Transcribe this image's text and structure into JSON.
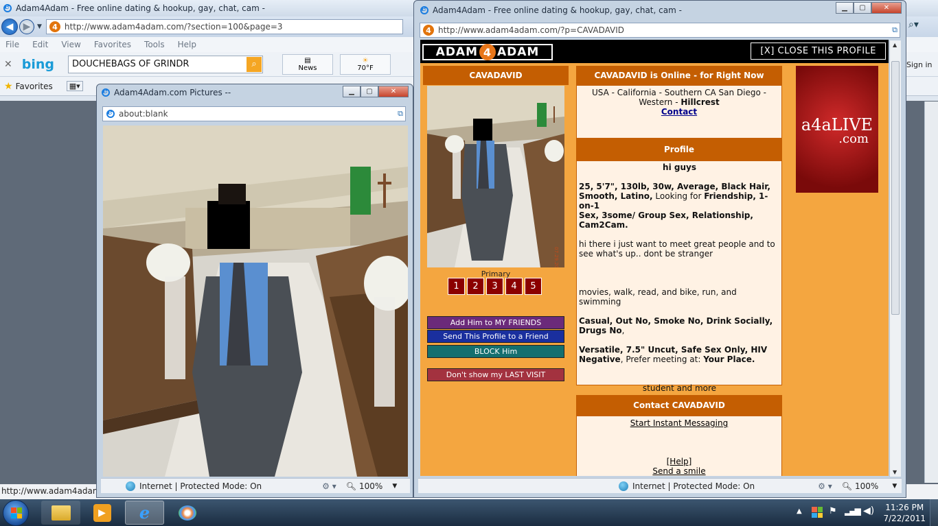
{
  "background_window": {
    "title": "Adam4Adam - Free online dating & hookup, gay, chat, cam -",
    "address": "http://www.adam4adam.com/?section=100&page=3",
    "menu": [
      "File",
      "Edit",
      "View",
      "Favorites",
      "Tools",
      "Help"
    ],
    "bing_search_value": "DOUCHEBAGS OF GRINDR",
    "news_label": "News",
    "weather_label": "70°F",
    "favorites_label": "Favorites",
    "sign_in": "Sign in",
    "status_url": "http://www.adam4adam.co"
  },
  "pictures_window": {
    "title": "Adam4Adam.com Pictures --",
    "address": "about:blank",
    "status_zone": "Internet | Protected Mode: On",
    "zoom": "100%"
  },
  "profile_window": {
    "title": "Adam4Adam - Free online dating & hookup, gay, chat, cam -",
    "address": "http://www.adam4adam.com/?p=CAVADAVID",
    "status_zone": "Internet | Protected Mode: On",
    "zoom": "100%"
  },
  "profile": {
    "logo_left": "ADAM",
    "logo_mid": "4",
    "logo_right": "ADAM",
    "close_label": "[X]  CLOSE THIS PROFILE",
    "username": "CAVADAVID",
    "primary_label": "Primary",
    "photo_numbers": [
      "1",
      "2",
      "3",
      "4",
      "5"
    ],
    "buttons": {
      "add_friend": "Add Him to MY FRIENDS",
      "send_profile": "Send This Profile to a Friend",
      "block": "BLOCK Him",
      "last_visit": "Don't show my LAST VISIT"
    },
    "online_header": "CAVADAVID is Online - for Right Now",
    "location_line1": "USA - California - Southern CA San Diego -",
    "location_line2_a": "Western - ",
    "location_line2_b": "Hillcrest",
    "contact_link": "Contact",
    "profile_header": "Profile",
    "greeting": "hi guys",
    "stats_a": "25, 5'7\", 130lb, 30w, Average, Black Hair,",
    "stats_b": "Smooth, Latino,",
    "stats_c": " Looking for ",
    "stats_d": "Friendship, 1-on-1",
    "stats_e": "Sex, 3some/ Group Sex, Relationship,",
    "stats_f": "Cam2Cam.",
    "about": "hi there i just want to meet great people and to see what's up.. dont be stranger",
    "hobbies": "movies, walk, read, and bike, run, and swimming",
    "habits_a": "Casual, Out No, Smoke No, Drink Socially,",
    "habits_b": "Drugs No",
    "habits_c": ",",
    "sex_a": "Versatile, 7.5\" Uncut, Safe Sex Only, HIV",
    "sex_b": "Negative",
    "sex_c": ", Prefer meeting at: ",
    "sex_d": "Your Place.",
    "occupation": "student and more",
    "contact_header": "Contact CAVADAVID",
    "im_link": "Start Instant Messaging",
    "help_link": "[Help]",
    "smile_link": "Send a smile",
    "ad_line1": "a4aLIVE",
    "ad_line2": ".com"
  },
  "taskbar": {
    "time": "11:26 PM",
    "date": "7/22/2011"
  },
  "colors": {
    "a4a_orange": "#f4a640",
    "header_orange": "#c45e02",
    "panel_cream": "#fff2e4",
    "photo_number_red": "#8b0000",
    "btn_purple": "#6b2a7a",
    "btn_blue": "#1a2f9e",
    "btn_teal": "#146f6f",
    "btn_rose": "#a3323f"
  }
}
